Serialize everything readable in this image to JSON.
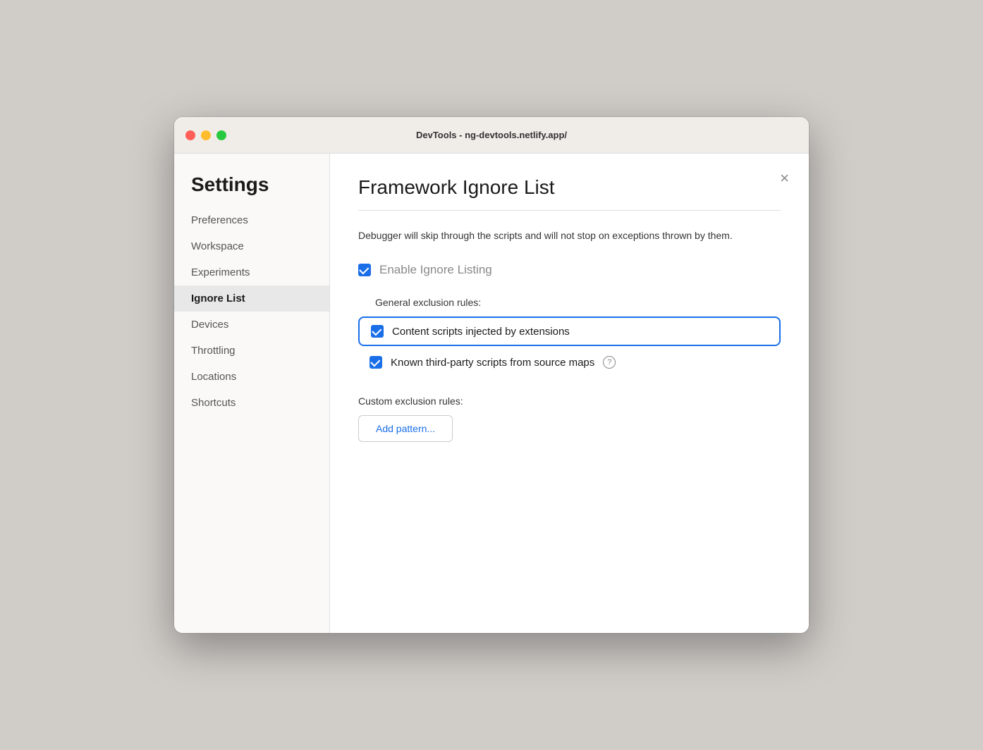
{
  "window": {
    "title": "DevTools - ng-devtools.netlify.app/"
  },
  "sidebar": {
    "heading": "Settings",
    "items": [
      {
        "id": "preferences",
        "label": "Preferences",
        "active": false
      },
      {
        "id": "workspace",
        "label": "Workspace",
        "active": false
      },
      {
        "id": "experiments",
        "label": "Experiments",
        "active": false
      },
      {
        "id": "ignore-list",
        "label": "Ignore List",
        "active": true
      },
      {
        "id": "devices",
        "label": "Devices",
        "active": false
      },
      {
        "id": "throttling",
        "label": "Throttling",
        "active": false
      },
      {
        "id": "locations",
        "label": "Locations",
        "active": false
      },
      {
        "id": "shortcuts",
        "label": "Shortcuts",
        "active": false
      }
    ]
  },
  "panel": {
    "title": "Framework Ignore List",
    "description": "Debugger will skip through the scripts and will not stop on exceptions thrown by them.",
    "enable_label": "Enable Ignore Listing",
    "general_section_label": "General exclusion rules:",
    "rules": [
      {
        "id": "content-scripts",
        "label": "Content scripts injected by extensions",
        "checked": true,
        "highlighted": true,
        "has_help": false
      },
      {
        "id": "third-party-scripts",
        "label": "Known third-party scripts from source maps",
        "checked": true,
        "highlighted": false,
        "has_help": true
      }
    ],
    "custom_section_label": "Custom exclusion rules:",
    "add_pattern_label": "Add pattern...",
    "close_label": "×"
  }
}
